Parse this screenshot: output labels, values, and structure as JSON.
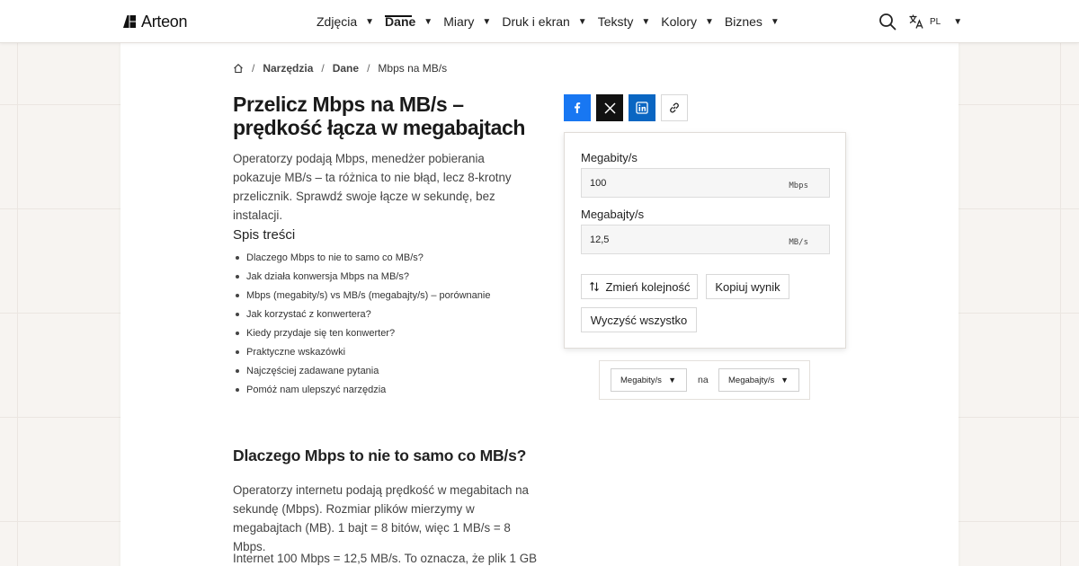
{
  "brand": {
    "name": "Arteon"
  },
  "nav": {
    "items": [
      {
        "label": "Zdjęcia",
        "active": false
      },
      {
        "label": "Dane",
        "active": true
      },
      {
        "label": "Miary",
        "active": false
      },
      {
        "label": "Druk i ekran",
        "active": false
      },
      {
        "label": "Teksty",
        "active": false
      },
      {
        "label": "Kolory",
        "active": false
      },
      {
        "label": "Biznes",
        "active": false
      }
    ],
    "language": "PL"
  },
  "breadcrumb": [
    "Narzędzia",
    "Dane",
    "Mbps na MB/s"
  ],
  "page": {
    "title_line1": "Przelicz Mbps na MB/s –",
    "title_line2": "prędkość łącza w megabajtach",
    "intro": "Operatorzy podają Mbps, menedżer pobierania pokazuje MB/s – ta różnica to nie błąd, lecz 8-krotny przelicznik. Sprawdź swoje łącze w sekundę, bez instalacji."
  },
  "toc": {
    "title": "Spis treści",
    "items": [
      "Dlaczego Mbps to nie to samo co MB/s?",
      "Jak działa konwersja Mbps na MB/s?",
      "Mbps (megabity/s) vs MB/s (megabajty/s) – porównanie",
      "Jak korzystać z konwertera?",
      "Kiedy przydaje się ten konwerter?",
      "Praktyczne wskazówki",
      "Najczęściej zadawane pytania",
      "Pomóż nam ulepszyć narzędzia"
    ]
  },
  "section": {
    "heading": "Dlaczego Mbps to nie to samo co MB/s?",
    "para1": "Operatorzy internetu podają prędkość w megabitach na sekundę (Mbps). Rozmiar plików mierzymy w megabajtach (MB). 1 bajt = 8 bitów, więc 1 MB/s = 8 Mbps.",
    "para2": "Internet 100 Mbps = 12,5 MB/s. To oznacza, że plik 1 GB"
  },
  "converter": {
    "from_label": "Megabity/s",
    "from_value": "100",
    "from_unit": "Mbps",
    "to_label": "Megabajty/s",
    "to_value": "12,5",
    "to_unit": "MB/s",
    "swap_label": "Zmień kolejność",
    "copy_label": "Kopiuj wynik",
    "clear_label": "Wyczyść wszystko"
  },
  "units": {
    "from": "Megabity/s",
    "connector": "na",
    "to": "Megabajty/s"
  },
  "colors": {
    "facebook": "#1877f2",
    "x": "#111111",
    "linkedin": "#0a66c2"
  }
}
